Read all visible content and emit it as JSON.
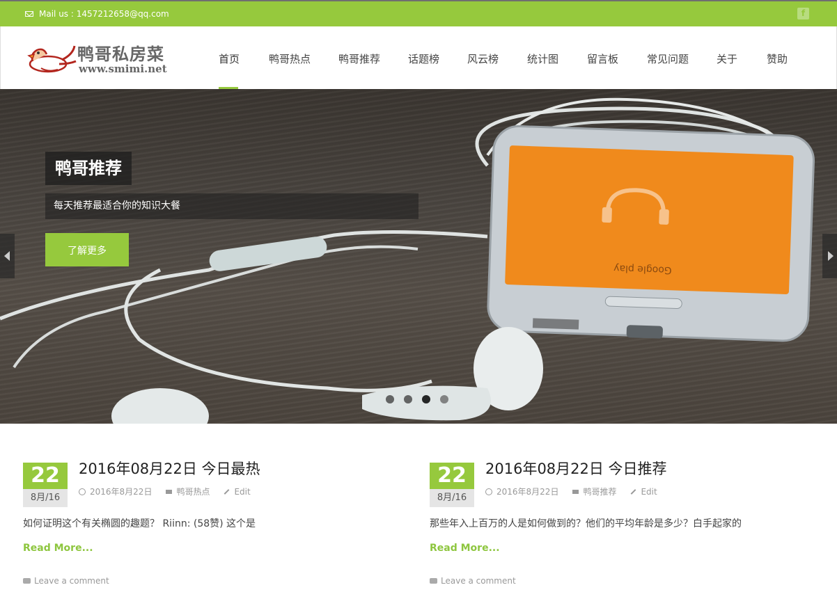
{
  "topbar": {
    "mail": "Mail us : 1457212658@qq.com",
    "social_icon": "facebook-icon",
    "social_glyph": "f"
  },
  "header": {
    "logo_title": "鸭哥私房菜",
    "logo_url": "www.smimi.net",
    "nav": [
      {
        "label": "首页",
        "active": true
      },
      {
        "label": "鸭哥热点"
      },
      {
        "label": "鸭哥推荐"
      },
      {
        "label": "话题榜"
      },
      {
        "label": "风云榜"
      },
      {
        "label": "统计图"
      },
      {
        "label": "留言板"
      },
      {
        "label": "常见问题"
      },
      {
        "label": "关于"
      },
      {
        "label": "赞助"
      }
    ]
  },
  "hero": {
    "title": "鸭哥推荐",
    "subtitle": "每天推荐最适合你的知识大餐",
    "cta": "了解更多",
    "screen_text": "Google play",
    "slides_total": 4,
    "slide_active": 3
  },
  "posts": [
    {
      "day": "22",
      "month_year": "8月/16",
      "title": "2016年08月22日 今日最热",
      "date": "2016年8月22日",
      "category": "鸭哥热点",
      "edit": "Edit",
      "excerpt": "如何证明这个有关椭圆的趣题？ Riinn: (58赞) 这个是",
      "read_more": "Read More...",
      "comment": "Leave a comment"
    },
    {
      "day": "22",
      "month_year": "8月/16",
      "title": "2016年08月22日 今日推荐",
      "date": "2016年8月22日",
      "category": "鸭哥推荐",
      "edit": "Edit",
      "excerpt": "那些年入上百万的人是如何做到的？他们的平均年龄是多少？白手起家的",
      "read_more": "Read More...",
      "comment": "Leave a comment"
    }
  ],
  "colors": {
    "accent": "#96c93d",
    "phone_screen": "#f08a1c"
  }
}
